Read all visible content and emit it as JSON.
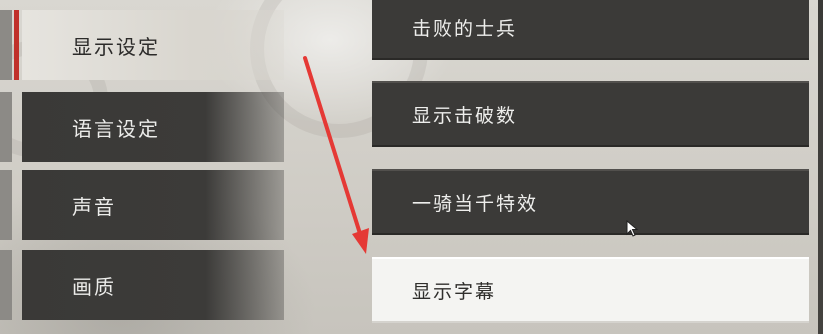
{
  "menu": {
    "items": [
      {
        "label": "显示设定",
        "active": true
      },
      {
        "label": "语言设定",
        "active": false
      },
      {
        "label": "声音",
        "active": false
      },
      {
        "label": "画质",
        "active": false
      }
    ]
  },
  "options": {
    "items": [
      {
        "label": "击败的士兵",
        "selected": false
      },
      {
        "label": "显示击破数",
        "selected": false
      },
      {
        "label": "一骑当千特效",
        "selected": false
      },
      {
        "label": "显示字幕",
        "selected": true
      }
    ]
  },
  "annotation": {
    "arrow_color": "#e53935"
  },
  "colors": {
    "accent_red": "#c0302a",
    "panel_dark": "#3b3a38",
    "panel_light": "#f4f4f2"
  }
}
